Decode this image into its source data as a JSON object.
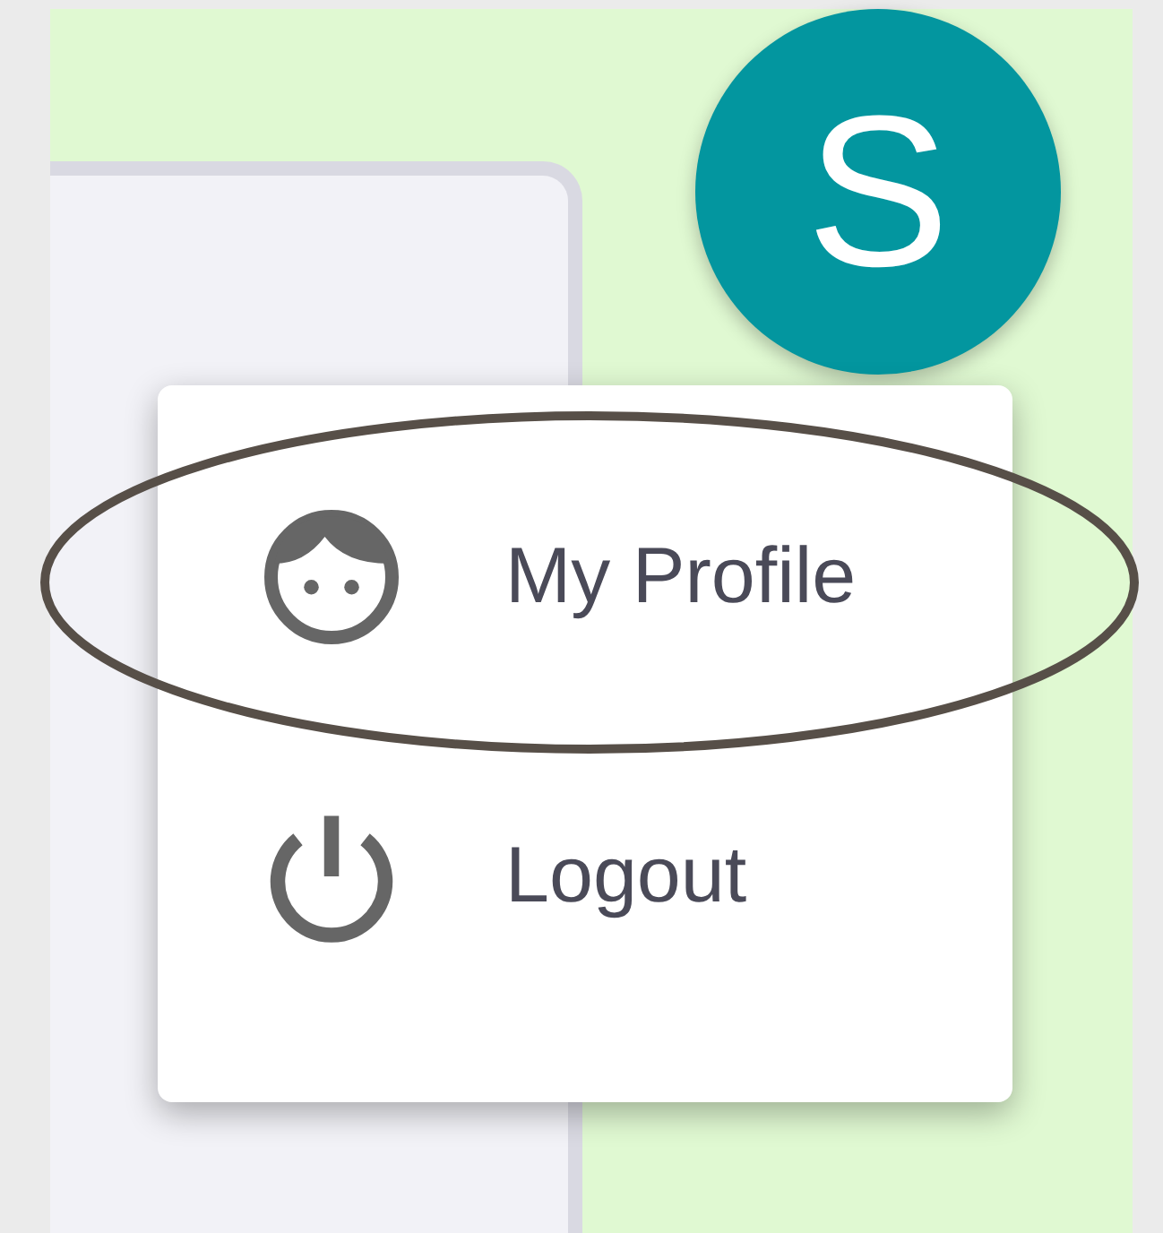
{
  "avatar": {
    "initial": "S"
  },
  "menu": {
    "items": [
      {
        "kind": "profile",
        "label": "My Profile",
        "highlighted": true
      },
      {
        "kind": "logout",
        "label": "Logout",
        "highlighted": false
      }
    ]
  }
}
